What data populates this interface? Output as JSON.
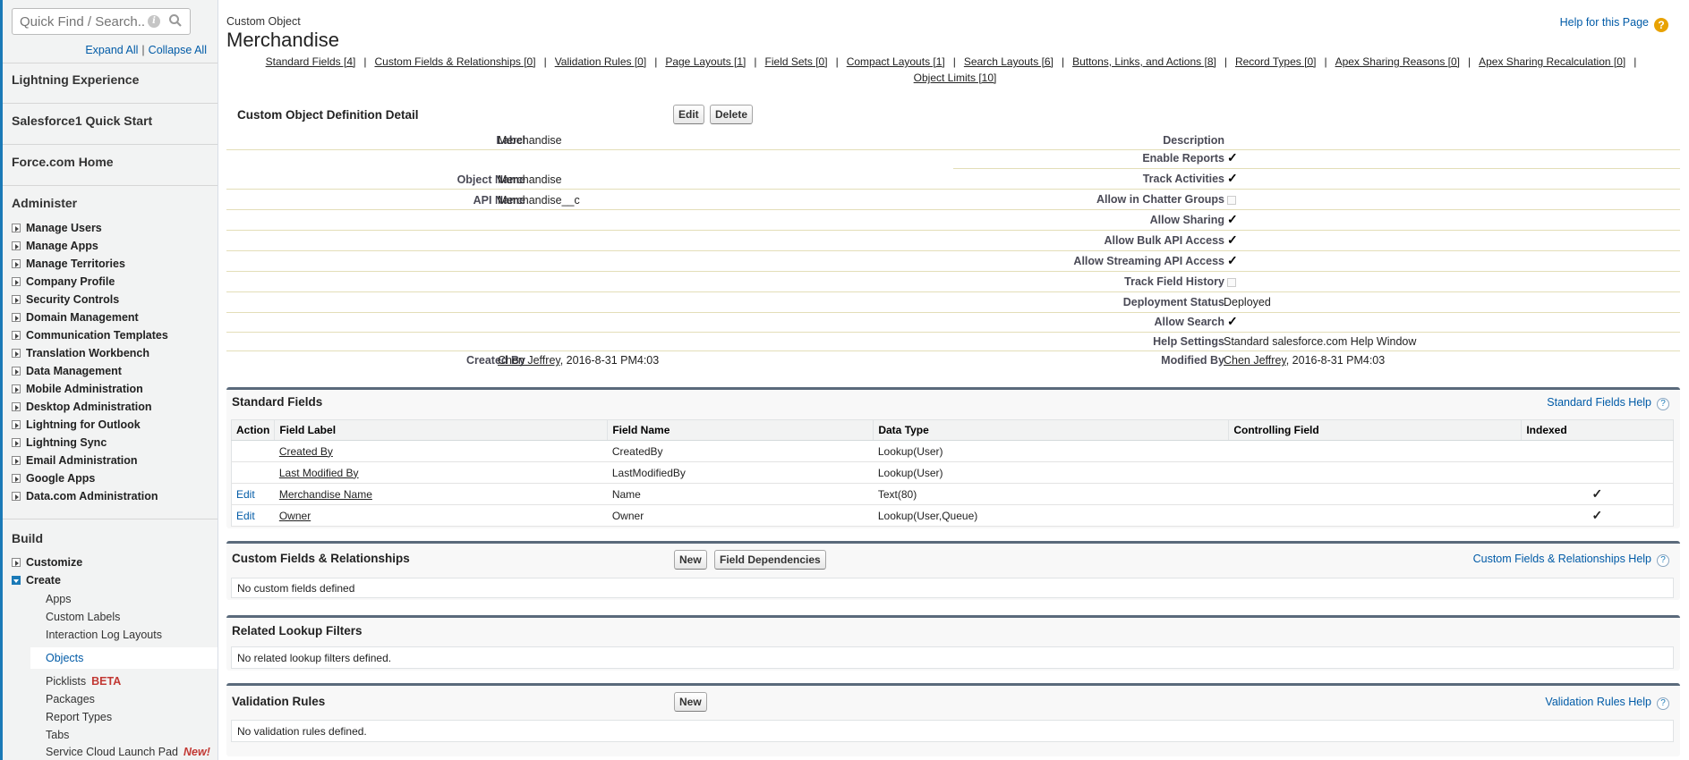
{
  "sidebar": {
    "quick_find_placeholder": "Quick Find / Search...",
    "expand_all": "Expand All",
    "collapse_all": "Collapse All",
    "sep": "|",
    "top_links": [
      "Lightning Experience",
      "Salesforce1 Quick Start",
      "Force.com Home"
    ],
    "administer_heading": "Administer",
    "administer_items": [
      "Manage Users",
      "Manage Apps",
      "Manage Territories",
      "Company Profile",
      "Security Controls",
      "Domain Management",
      "Communication Templates",
      "Translation Workbench",
      "Data Management",
      "Mobile Administration",
      "Desktop Administration",
      "Lightning for Outlook",
      "Lightning Sync",
      "Email Administration",
      "Google Apps",
      "Data.com Administration"
    ],
    "build_heading": "Build",
    "build_items": [
      "Customize",
      "Create"
    ],
    "create_sub": [
      "Apps",
      "Custom Labels",
      "Interaction Log Layouts",
      "Objects",
      "Picklists",
      "Packages",
      "Report Types",
      "Tabs",
      "Service Cloud Launch Pad"
    ],
    "beta_tag": "BETA",
    "new_tag": "New!"
  },
  "header": {
    "object_type": "Custom Object",
    "object_name": "Merchandise",
    "help_link": "Help for this Page",
    "help_icon": "?"
  },
  "related_links": [
    "Standard Fields [4]",
    "Custom Fields & Relationships [0]",
    "Validation Rules [0]",
    "Page Layouts [1]",
    "Field Sets [0]",
    "Compact Layouts [1]",
    "Search Layouts [6]",
    "Buttons, Links, and Actions [8]",
    "Record Types [0]",
    "Apex Sharing Reasons [0]",
    "Apex Sharing Recalculation [0]",
    "Object Limits [10]"
  ],
  "detail": {
    "title": "Custom Object Definition Detail",
    "edit_button": "Edit",
    "delete_button": "Delete",
    "label_label": "Label",
    "label_value": "Merchandise",
    "object_name_label": "Object Name",
    "object_name_value": "Merchandise",
    "api_name_label": "API Name",
    "api_name_value": "Merchandise__c",
    "created_by_label": "Created By",
    "created_by_user": "Chen Jeffrey",
    "created_by_date": ", 2016-8-31 PM4:03",
    "description_label": "Description",
    "enable_reports_label": "Enable Reports",
    "track_activities_label": "Track Activities",
    "allow_chatter_label": "Allow in Chatter Groups",
    "allow_sharing_label": "Allow Sharing",
    "allow_bulk_label": "Allow Bulk API Access",
    "allow_streaming_label": "Allow Streaming API Access",
    "track_history_label": "Track Field History",
    "deployment_status_label": "Deployment Status",
    "deployment_status_value": "Deployed",
    "allow_search_label": "Allow Search",
    "help_settings_label": "Help Settings",
    "help_settings_value": "Standard salesforce.com Help Window",
    "modified_by_label": "Modified By",
    "modified_by_user": "Chen Jeffrey",
    "modified_by_date": ", 2016-8-31 PM4:03",
    "checkmark": "✓"
  },
  "standard_fields": {
    "title": "Standard Fields",
    "help": "Standard Fields Help",
    "headers": [
      "Action",
      "Field Label",
      "Field Name",
      "Data Type",
      "Controlling Field",
      "Indexed"
    ],
    "rows": [
      {
        "action": "",
        "label": "Created By",
        "name": "CreatedBy",
        "type": "Lookup(User)",
        "indexed": ""
      },
      {
        "action": "",
        "label": "Last Modified By",
        "name": "LastModifiedBy",
        "type": "Lookup(User)",
        "indexed": ""
      },
      {
        "action": "Edit",
        "label": "Merchandise Name",
        "name": "Name",
        "type": "Text(80)",
        "indexed": "✓"
      },
      {
        "action": "Edit",
        "label": "Owner",
        "name": "Owner",
        "type": "Lookup(User,Queue)",
        "indexed": "✓"
      }
    ]
  },
  "custom_fields": {
    "title": "Custom Fields & Relationships",
    "new_button": "New",
    "deps_button": "Field Dependencies",
    "help": "Custom Fields & Relationships Help",
    "empty": "No custom fields defined"
  },
  "lookup_filters": {
    "title": "Related Lookup Filters",
    "empty": "No related lookup filters defined."
  },
  "validation_rules": {
    "title": "Validation Rules",
    "new_button": "New",
    "help": "Validation Rules Help",
    "empty": "No validation rules defined."
  }
}
